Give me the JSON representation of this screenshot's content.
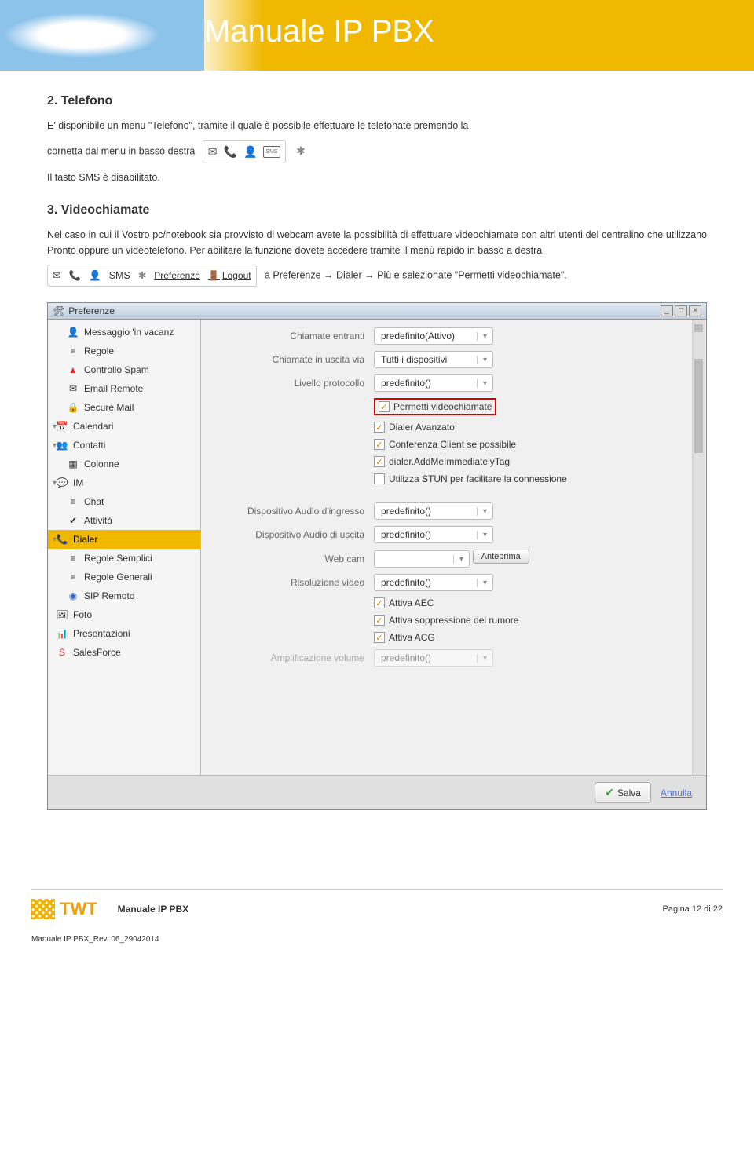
{
  "header": {
    "title": "Manuale IP PBX"
  },
  "sec2": {
    "heading": "2. Telefono",
    "p1a": "E' disponibile un menu \"Telefono\", tramite il quale è possibile effettuare le telefonate premendo la",
    "p1b": "cornetta dal menu in basso destra",
    "p2": "Il tasto SMS è disabilitato."
  },
  "sec3": {
    "heading": "3. Videochiamate",
    "p1": "Nel caso in cui il Vostro pc/notebook sia provvisto di webcam avete la possibilità di effettuare videochiamate con altri utenti del centralino che utilizzano Pronto oppure un videotelefono. Per abilitare la funzione dovete accedere tramite il menù rapido in basso a destra",
    "p2": "a Preferenze → Dialer → Più e selezionate \"Permetti videochiamate\"."
  },
  "toolbar2": {
    "pref": "Preferenze",
    "logout": "Logout"
  },
  "prefwin": {
    "title": "Preferenze",
    "sidebar": [
      {
        "icon": "person",
        "label": "Messaggio 'in vacanz",
        "indent": 1
      },
      {
        "icon": "lines",
        "label": "Regole",
        "indent": 1
      },
      {
        "icon": "warn",
        "label": "Controllo Spam",
        "indent": 1
      },
      {
        "icon": "mail",
        "label": "Email Remote",
        "indent": 1
      },
      {
        "icon": "lock",
        "label": "Secure Mail",
        "indent": 1
      },
      {
        "icon": "cal",
        "label": "Calendari",
        "indent": 0,
        "tri": true
      },
      {
        "icon": "contact",
        "label": "Contatti",
        "indent": 0,
        "tri": true
      },
      {
        "icon": "cols",
        "label": "Colonne",
        "indent": 1
      },
      {
        "icon": "im",
        "label": "IM",
        "indent": 0,
        "tri": true
      },
      {
        "icon": "lines",
        "label": "Chat",
        "indent": 1
      },
      {
        "icon": "check",
        "label": "Attività",
        "indent": 1
      },
      {
        "icon": "phone",
        "label": "Dialer",
        "indent": 0,
        "tri": true,
        "active": true
      },
      {
        "icon": "lines",
        "label": "Regole Semplici",
        "indent": 1
      },
      {
        "icon": "lines",
        "label": "Regole Generali",
        "indent": 1
      },
      {
        "icon": "sip",
        "label": "SIP Remoto",
        "indent": 1
      },
      {
        "icon": "photo",
        "label": "Foto",
        "indent": 0
      },
      {
        "icon": "pres",
        "label": "Presentazioni",
        "indent": 0
      },
      {
        "icon": "sf",
        "label": "SalesForce",
        "indent": 0
      }
    ],
    "form": {
      "row1_label": "Chiamate entranti",
      "row1_val": "predefinito(Attivo)",
      "row2_label": "Chiamate in uscita via",
      "row2_val": "Tutti i dispositivi",
      "row3_label": "Livello protocollo",
      "row3_val": "predefinito()",
      "chk1": "Permetti videochiamate",
      "chk2": "Dialer Avanzato",
      "chk3": "Conferenza Client se possibile",
      "chk4": "dialer.AddMeImmediatelyTag",
      "chk5": "Utilizza  STUN per facilitare la connessione",
      "row6_label": "Dispositivo Audio d'ingresso",
      "row6_val": "predefinito()",
      "row7_label": "Dispositivo Audio di uscita",
      "row7_val": "predefinito()",
      "row8_label": "Web cam",
      "row8_btn": "Anteprima",
      "row9_label": "Risoluzione video",
      "row9_val": "predefinito()",
      "chk6": "Attiva AEC",
      "chk7": "Attiva soppressione del rumore",
      "chk8": "Attiva ACG",
      "row10_label": "Amplificazione volume",
      "row10_val": "predefinito()"
    },
    "footer": {
      "save": "Salva",
      "cancel": "Annulla"
    }
  },
  "footer": {
    "logo": "TWT",
    "center": "Manuale IP PBX",
    "right": "Pagina 12 di 22",
    "rev": "Manuale IP PBX_Rev. 06_29042014"
  }
}
